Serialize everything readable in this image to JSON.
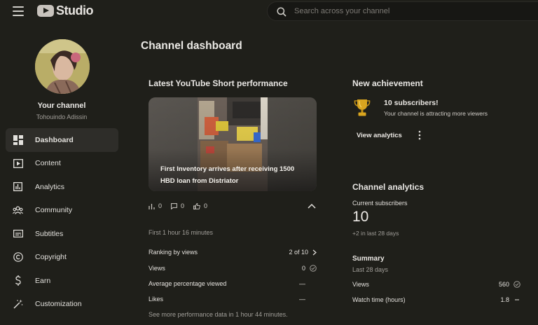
{
  "app": {
    "logo_text": "Studio"
  },
  "search": {
    "placeholder": "Search across your channel"
  },
  "channel": {
    "title": "Your channel",
    "name": "Tohouindo Adissin"
  },
  "sidebar": {
    "items": [
      {
        "label": "Dashboard",
        "icon": "dashboard-icon",
        "active": true
      },
      {
        "label": "Content",
        "icon": "content-icon"
      },
      {
        "label": "Analytics",
        "icon": "analytics-icon"
      },
      {
        "label": "Community",
        "icon": "community-icon"
      },
      {
        "label": "Subtitles",
        "icon": "subtitles-icon"
      },
      {
        "label": "Copyright",
        "icon": "copyright-icon"
      },
      {
        "label": "Earn",
        "icon": "earn-icon"
      },
      {
        "label": "Customization",
        "icon": "customization-icon"
      }
    ]
  },
  "main": {
    "title": "Channel dashboard",
    "short_card": {
      "title": "Latest YouTube Short performance",
      "caption": "First Inventory arrives after receiving 1500 HBD loan from Distriator",
      "views": "0",
      "comments": "0",
      "likes": "0",
      "period": "First 1 hour 16 minutes",
      "rows": [
        {
          "label": "Ranking by views",
          "value": "2 of 10"
        },
        {
          "label": "Views",
          "value": "0"
        },
        {
          "label": "Average percentage viewed",
          "value": "—"
        },
        {
          "label": "Likes",
          "value": "—"
        }
      ],
      "footer": "See more performance data in 1 hour 44 minutes."
    },
    "achievement": {
      "title": "New achievement",
      "headline": "10 subscribers!",
      "subtitle": "Your channel is attracting more viewers",
      "button": "View analytics"
    },
    "analytics": {
      "title": "Channel analytics",
      "subs_label": "Current subscribers",
      "subs_value": "10",
      "subs_change": "+2 in last 28 days",
      "summary_title": "Summary",
      "summary_period": "Last 28 days",
      "rows": [
        {
          "label": "Views",
          "value": "560"
        },
        {
          "label": "Watch time (hours)",
          "value": "1.8"
        }
      ]
    }
  },
  "colors": {
    "background": "#1f1f1a",
    "accent_trophy": "#d9a51f"
  }
}
